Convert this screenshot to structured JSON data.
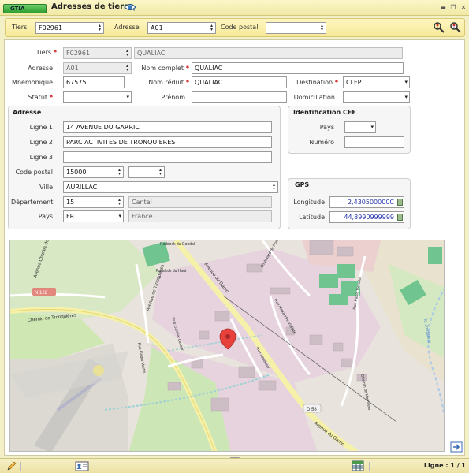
{
  "app": {
    "badge": "GTIA",
    "title": "Adresses de tiers"
  },
  "search": {
    "tiers_label": "Tiers",
    "tiers_value": "F02961",
    "adresse_label": "Adresse",
    "adresse_value": "A01",
    "cp_label": "Code postal",
    "cp_value": ""
  },
  "form": {
    "tiers_label": "Tiers",
    "tiers_code": "F02961",
    "tiers_name": "QUALIAC",
    "adresse_label": "Adresse",
    "adresse_value": "A01",
    "nom_complet_label": "Nom complet",
    "nom_complet_value": "QUALIAC",
    "mnemonique_label": "Mnémonique",
    "mnemonique_value": "67575",
    "nom_reduit_label": "Nom réduit",
    "nom_reduit_value": "QUALIAC",
    "destination_label": "Destination",
    "destination_value": "CLFP",
    "statut_label": "Statut",
    "statut_value": ".",
    "prenom_label": "Prénom",
    "prenom_value": "",
    "domiciliation_label": "Domiciliation",
    "domiciliation_value": ""
  },
  "adresse_group": {
    "title": "Adresse",
    "ligne1_label": "Ligne 1",
    "ligne1_value": "14 AVENUE DU GARRIC",
    "ligne2_label": "Ligne 2",
    "ligne2_value": "PARC ACTIVITES DE TRONQUIERES",
    "ligne3_label": "Ligne 3",
    "ligne3_value": "",
    "cp_label": "Code postal",
    "cp_value": "15000",
    "cp_extra": "",
    "ville_label": "Ville",
    "ville_value": "AURILLAC",
    "dept_label": "Département",
    "dept_code": "15",
    "dept_name": "Cantal",
    "pays_label": "Pays",
    "pays_code": "FR",
    "pays_name": "France"
  },
  "cee_group": {
    "title": "Identification CEE",
    "pays_label": "Pays",
    "pays_value": "",
    "numero_label": "Numéro",
    "numero_value": ""
  },
  "gps_group": {
    "title": "GPS",
    "longitude_label": "Longitude",
    "longitude_value": "2,430500000C",
    "latitude_label": "Latitude",
    "latitude_value": "44,8990999999"
  },
  "map": {
    "roads": [
      "Avenue Charles de Gaulle",
      "N 122",
      "Chemin de Tronquières",
      "Avenue de Tronquières",
      "Avenue du Garric",
      "Rue Garnier Lavaur",
      "Rue Dagot Martin",
      "Rue Alexandre Vialatte",
      "Boulevard du Pont Rouge",
      "Rue Lavoisier",
      "Rue Pablo Neruda",
      "Chemin de Marmiers",
      "D 58"
    ],
    "places": [
      "Paddock du Gondal",
      "Paddock du Haut"
    ],
    "water": "la Jordanne"
  },
  "status": {
    "ligne": "Ligne : 1 / 1"
  },
  "colors": {
    "accent": "#f1e9a6",
    "required": "#cc0000",
    "gps_value": "#2233aa",
    "map_residential": "#e6d3de",
    "map_green": "#cfe7b3"
  }
}
